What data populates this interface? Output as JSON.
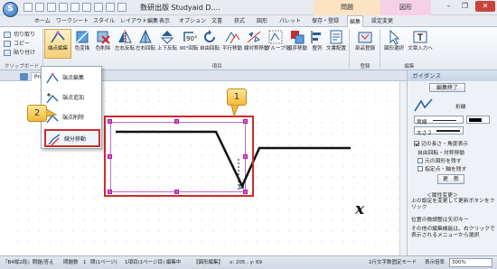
{
  "app": {
    "logo_letter": "S",
    "title": "数研出版 Studyaid D....",
    "context_tab_1": "問題",
    "context_tab_2": "図形"
  },
  "window_controls": {
    "minimize": "–",
    "restore": "❐",
    "close": "✕"
  },
  "tabs": [
    "ホーム",
    "ワークシート",
    "スタイル",
    "レイアウト編集",
    "表示",
    "オプション",
    "文書",
    "获式",
    "図形",
    "パレット",
    "保存・登録",
    "編集",
    "設定変更"
  ],
  "selected_tab": "編集",
  "clipboard": {
    "cut": "切り取り",
    "copy": "コピー",
    "paste": "貼り付け",
    "group_label": "クリップボード"
  },
  "ribbon_buttons": [
    {
      "label": "端点編集"
    },
    {
      "label": "色変換"
    },
    {
      "label": "色削除"
    },
    {
      "label": "左右反転"
    },
    {
      "label": "左右回転"
    },
    {
      "label": "上下反転"
    },
    {
      "label": "90°回転"
    },
    {
      "label": "自由回転"
    },
    {
      "label": "平行移動"
    },
    {
      "label": "線対称移動"
    },
    {
      "label": "グループ化"
    },
    {
      "label": "順序移動"
    },
    {
      "label": "整列"
    },
    {
      "label": "文書配置"
    },
    {
      "label": "部品登録"
    },
    {
      "label": "図形選択"
    },
    {
      "label": "文章入力へ"
    }
  ],
  "ribbon_groups": {
    "main": "項目",
    "register": "登録",
    "edit": "編集"
  },
  "document_tab": "Prin",
  "dropdown_menu": [
    "端点編集",
    "端点追加",
    "端点削除",
    "線分移動"
  ],
  "callouts": [
    "1",
    "2"
  ],
  "axis_label": "x",
  "guidance_panel": {
    "title": "ガイダンス",
    "finish_button": "編集終了",
    "shape_label": "折線",
    "line_style": "実線",
    "line_width": "太さ２",
    "check_length_angle": "辺の長さ・角度表示",
    "section_rotate": "自由回転・対称移動",
    "check_keep_original": "元の図形を残す",
    "check_axis": "指定点・軸を残す",
    "update_button": "更　新",
    "attr_change": "＜属性変更＞",
    "desc1": "上の設定を変更して更新ボタンをクリック",
    "desc2": "位置の微調整は矢印キー",
    "desc3": "その他の編集機能は、右クリックで表示されるメニューから選択"
  },
  "status_bar": {
    "mode": "『B4縦2段』問題/答え",
    "problem": "問題数　1",
    "page": "問(1ページ)",
    "item": "1項目(1ページ目) 編集中",
    "shape": "【図形編集】",
    "coords": "x: 205 , y: 69",
    "print_mode": "1行文字数固定モード",
    "zoom_label": "表示倍率",
    "zoom_value": "300%"
  },
  "colors": {
    "accent_red": "#d02a2a",
    "handle": "#e64fd8",
    "callout": "#f2b93a"
  }
}
